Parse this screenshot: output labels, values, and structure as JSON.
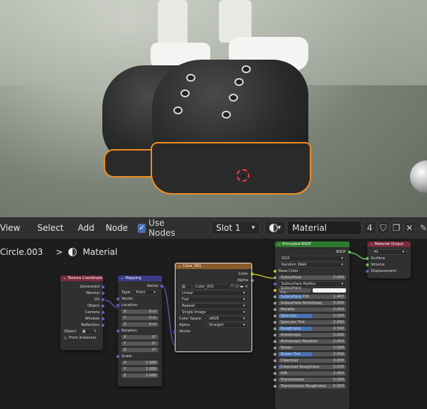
{
  "header": {
    "menus": [
      "View",
      "Select",
      "Add",
      "Node"
    ],
    "use_nodes_label": "Use Nodes",
    "slot_label": "Slot 1",
    "material_name": "Material",
    "user_count": "4"
  },
  "breadcrumb": {
    "object": "Circle.003",
    "separator": ">",
    "material": "Material"
  },
  "nodes": {
    "texcoord": {
      "title": "Texture Coordinate",
      "outputs": [
        "Generated",
        "Normal",
        "UV",
        "Object",
        "Camera",
        "Window",
        "Reflection"
      ],
      "object_label": "Object:",
      "from_instancer": "From Instancer"
    },
    "mapping": {
      "title": "Mapping",
      "out": "Vector",
      "type_label": "Type:",
      "type_value": "Point",
      "vector": "Vector",
      "location": "Location:",
      "loc": [
        [
          "X",
          "0 m"
        ],
        [
          "Y",
          "0 m"
        ],
        [
          "Z",
          "0 m"
        ]
      ],
      "rotation": "Rotation:",
      "rot": [
        [
          "X",
          "0°"
        ],
        [
          "Y",
          "0°"
        ],
        [
          "Z",
          "0°"
        ]
      ],
      "scale": "Scale:",
      "scl": [
        [
          "X",
          "1.000"
        ],
        [
          "Y",
          "1.000"
        ],
        [
          "Z",
          "1.000"
        ]
      ]
    },
    "image": {
      "title": "Color_001",
      "out_color": "Color",
      "out_alpha": "Alpha",
      "image_name": "Color_001",
      "interp": "Linear",
      "proj": "Flat",
      "ext": "Repeat",
      "source": "Single Image",
      "cs_label": "Color Space",
      "cs_value": "sRGB",
      "alpha_label": "Alpha",
      "alpha_value": "Straight",
      "vector": "Vector"
    },
    "bsdf": {
      "title": "Principled BSDF",
      "out": "BSDF",
      "dist": "GGX",
      "sss": "Random Walk",
      "base_color": "Base Color",
      "rows": [
        {
          "label": "Subsurface",
          "value": "0.000",
          "fill": 0
        },
        {
          "label": "Subsurface Radius",
          "value": "",
          "fill": 0,
          "drop": true
        },
        {
          "label": "Subsurface Co...",
          "value": "",
          "fill": 0,
          "white": true
        },
        {
          "label": "Subsurface IOR",
          "value": "1.400",
          "fill": 0.35
        },
        {
          "label": "Subsurface Anisotropy",
          "value": "0.000",
          "fill": 0
        },
        {
          "label": "Metallic",
          "value": "0.000",
          "fill": 0
        },
        {
          "label": "Specular",
          "value": "0.500",
          "fill": 0.5
        },
        {
          "label": "Specular Tint",
          "value": "0.000",
          "fill": 0
        },
        {
          "label": "Roughness",
          "value": "0.500",
          "fill": 0.5
        },
        {
          "label": "Anisotropic",
          "value": "0.000",
          "fill": 0
        },
        {
          "label": "Anisotropic Rotation",
          "value": "0.000",
          "fill": 0
        },
        {
          "label": "Sheen",
          "value": "0.000",
          "fill": 0
        },
        {
          "label": "Sheen Tint",
          "value": "0.500",
          "fill": 0.5
        },
        {
          "label": "Clearcoat",
          "value": "0.000",
          "fill": 0
        },
        {
          "label": "Clearcoat Roughness",
          "value": "0.030",
          "fill": 0.03
        },
        {
          "label": "IOR",
          "value": "1.450",
          "fill": 0
        },
        {
          "label": "Transmission",
          "value": "0.000",
          "fill": 0
        },
        {
          "label": "Transmission Roughness",
          "value": "0.000",
          "fill": 0
        }
      ]
    },
    "output": {
      "title": "Material Output",
      "target": "All",
      "inputs": [
        "Surface",
        "Volume",
        "Displacement"
      ]
    }
  },
  "colors": {
    "accent": "#4772b3",
    "selection": "#f08c23",
    "socket_yellow": "#c7c729",
    "socket_purple": "#6363c7",
    "socket_gray": "#a1a1a1",
    "socket_green": "#63c763"
  }
}
